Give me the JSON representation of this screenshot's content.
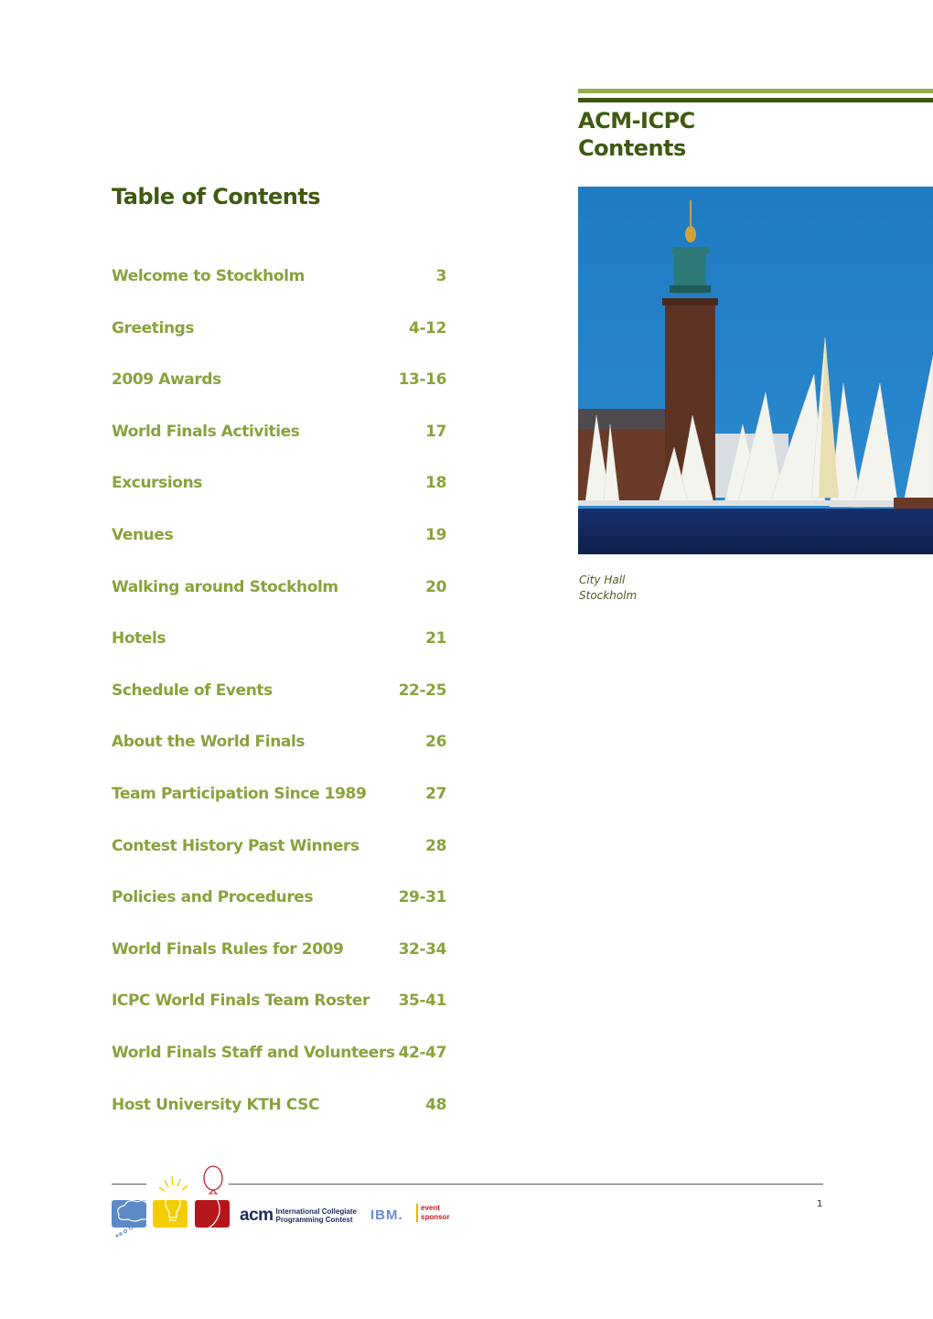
{
  "header": {
    "title_line1": "ACM-ICPC",
    "title_line2": "Contents",
    "accent_light": "#97ac4b",
    "accent_dark": "#3d560c"
  },
  "page_title": "Table of Contents",
  "toc": [
    {
      "title": "Welcome to Stockholm",
      "pages": "3"
    },
    {
      "title": "Greetings",
      "pages": "4-12"
    },
    {
      "title": "2009 Awards",
      "pages": "13-16"
    },
    {
      "title": "World Finals Activities",
      "pages": "17"
    },
    {
      "title": "Excursions",
      "pages": "18"
    },
    {
      "title": "Venues",
      "pages": "19"
    },
    {
      "title": "Walking around Stockholm",
      "pages": "20"
    },
    {
      "title": "Hotels",
      "pages": "21"
    },
    {
      "title": "Schedule of Events",
      "pages": "22-25"
    },
    {
      "title": "About the World Finals",
      "pages": "26"
    },
    {
      "title": "Team Participation Since 1989",
      "pages": "27"
    },
    {
      "title": "Contest History Past Winners",
      "pages": "28"
    },
    {
      "title": "Policies and Procedures",
      "pages": "29-31"
    },
    {
      "title": "World Finals Rules for 2009",
      "pages": "32-34"
    },
    {
      "title": "ICPC World Finals Team Roster",
      "pages": "35-41"
    },
    {
      "title": "World Finals Staff and Volunteers",
      "pages": "42-47"
    },
    {
      "title": "Host University KTH CSC",
      "pages": "48"
    }
  ],
  "photo": {
    "subject": "City Hall tower with sailboats"
  },
  "caption": {
    "line1": "City Hall",
    "line2": "Stockholm"
  },
  "footer": {
    "acm_word": "acm",
    "acm_line1": "International Collegiate",
    "acm_line2": "Programming Contest",
    "ibm": "IBM.",
    "sponsor_line1": "event",
    "sponsor_line2": "sponsor",
    "page_number": "1"
  }
}
